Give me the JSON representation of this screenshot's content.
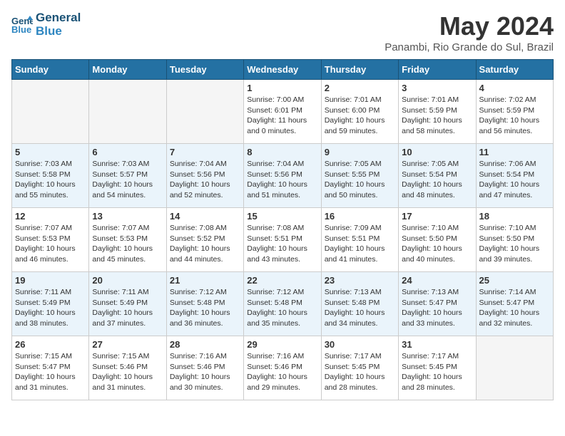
{
  "header": {
    "logo_line1": "General",
    "logo_line2": "Blue",
    "month": "May 2024",
    "location": "Panambi, Rio Grande do Sul, Brazil"
  },
  "weekdays": [
    "Sunday",
    "Monday",
    "Tuesday",
    "Wednesday",
    "Thursday",
    "Friday",
    "Saturday"
  ],
  "weeks": [
    [
      {
        "day": "",
        "empty": true
      },
      {
        "day": "",
        "empty": true
      },
      {
        "day": "",
        "empty": true
      },
      {
        "day": "1",
        "sunrise": "7:00 AM",
        "sunset": "6:01 PM",
        "daylight": "11 hours and 0 minutes."
      },
      {
        "day": "2",
        "sunrise": "7:01 AM",
        "sunset": "6:00 PM",
        "daylight": "10 hours and 59 minutes."
      },
      {
        "day": "3",
        "sunrise": "7:01 AM",
        "sunset": "5:59 PM",
        "daylight": "10 hours and 58 minutes."
      },
      {
        "day": "4",
        "sunrise": "7:02 AM",
        "sunset": "5:59 PM",
        "daylight": "10 hours and 56 minutes."
      }
    ],
    [
      {
        "day": "5",
        "sunrise": "7:03 AM",
        "sunset": "5:58 PM",
        "daylight": "10 hours and 55 minutes."
      },
      {
        "day": "6",
        "sunrise": "7:03 AM",
        "sunset": "5:57 PM",
        "daylight": "10 hours and 54 minutes."
      },
      {
        "day": "7",
        "sunrise": "7:04 AM",
        "sunset": "5:56 PM",
        "daylight": "10 hours and 52 minutes."
      },
      {
        "day": "8",
        "sunrise": "7:04 AM",
        "sunset": "5:56 PM",
        "daylight": "10 hours and 51 minutes."
      },
      {
        "day": "9",
        "sunrise": "7:05 AM",
        "sunset": "5:55 PM",
        "daylight": "10 hours and 50 minutes."
      },
      {
        "day": "10",
        "sunrise": "7:05 AM",
        "sunset": "5:54 PM",
        "daylight": "10 hours and 48 minutes."
      },
      {
        "day": "11",
        "sunrise": "7:06 AM",
        "sunset": "5:54 PM",
        "daylight": "10 hours and 47 minutes."
      }
    ],
    [
      {
        "day": "12",
        "sunrise": "7:07 AM",
        "sunset": "5:53 PM",
        "daylight": "10 hours and 46 minutes."
      },
      {
        "day": "13",
        "sunrise": "7:07 AM",
        "sunset": "5:53 PM",
        "daylight": "10 hours and 45 minutes."
      },
      {
        "day": "14",
        "sunrise": "7:08 AM",
        "sunset": "5:52 PM",
        "daylight": "10 hours and 44 minutes."
      },
      {
        "day": "15",
        "sunrise": "7:08 AM",
        "sunset": "5:51 PM",
        "daylight": "10 hours and 43 minutes."
      },
      {
        "day": "16",
        "sunrise": "7:09 AM",
        "sunset": "5:51 PM",
        "daylight": "10 hours and 41 minutes."
      },
      {
        "day": "17",
        "sunrise": "7:10 AM",
        "sunset": "5:50 PM",
        "daylight": "10 hours and 40 minutes."
      },
      {
        "day": "18",
        "sunrise": "7:10 AM",
        "sunset": "5:50 PM",
        "daylight": "10 hours and 39 minutes."
      }
    ],
    [
      {
        "day": "19",
        "sunrise": "7:11 AM",
        "sunset": "5:49 PM",
        "daylight": "10 hours and 38 minutes."
      },
      {
        "day": "20",
        "sunrise": "7:11 AM",
        "sunset": "5:49 PM",
        "daylight": "10 hours and 37 minutes."
      },
      {
        "day": "21",
        "sunrise": "7:12 AM",
        "sunset": "5:48 PM",
        "daylight": "10 hours and 36 minutes."
      },
      {
        "day": "22",
        "sunrise": "7:12 AM",
        "sunset": "5:48 PM",
        "daylight": "10 hours and 35 minutes."
      },
      {
        "day": "23",
        "sunrise": "7:13 AM",
        "sunset": "5:48 PM",
        "daylight": "10 hours and 34 minutes."
      },
      {
        "day": "24",
        "sunrise": "7:13 AM",
        "sunset": "5:47 PM",
        "daylight": "10 hours and 33 minutes."
      },
      {
        "day": "25",
        "sunrise": "7:14 AM",
        "sunset": "5:47 PM",
        "daylight": "10 hours and 32 minutes."
      }
    ],
    [
      {
        "day": "26",
        "sunrise": "7:15 AM",
        "sunset": "5:47 PM",
        "daylight": "10 hours and 31 minutes."
      },
      {
        "day": "27",
        "sunrise": "7:15 AM",
        "sunset": "5:46 PM",
        "daylight": "10 hours and 31 minutes."
      },
      {
        "day": "28",
        "sunrise": "7:16 AM",
        "sunset": "5:46 PM",
        "daylight": "10 hours and 30 minutes."
      },
      {
        "day": "29",
        "sunrise": "7:16 AM",
        "sunset": "5:46 PM",
        "daylight": "10 hours and 29 minutes."
      },
      {
        "day": "30",
        "sunrise": "7:17 AM",
        "sunset": "5:45 PM",
        "daylight": "10 hours and 28 minutes."
      },
      {
        "day": "31",
        "sunrise": "7:17 AM",
        "sunset": "5:45 PM",
        "daylight": "10 hours and 28 minutes."
      },
      {
        "day": "",
        "empty": true
      }
    ]
  ]
}
